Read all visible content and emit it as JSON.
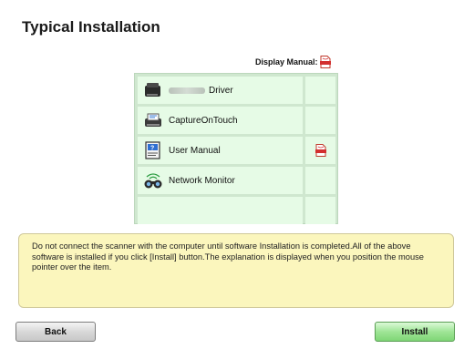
{
  "title": "Typical Installation",
  "display_manual": {
    "label": "Display Manual:",
    "icon": "pdf-icon"
  },
  "software_list": [
    {
      "label": "Driver",
      "icon": "scanner-icon",
      "has_manual": false,
      "name_blurred": true
    },
    {
      "label": "CaptureOnTouch",
      "icon": "scanner-capture-icon",
      "has_manual": false
    },
    {
      "label": "User Manual",
      "icon": "user-manual-icon",
      "has_manual": true
    },
    {
      "label": "Network Monitor",
      "icon": "network-monitor-icon",
      "has_manual": false
    },
    {
      "label": "",
      "icon": "",
      "has_manual": false
    }
  ],
  "notice": "Do not connect the scanner with the computer until software Installation is completed.All of the above software is installed if you click [Install] button.The explanation is displayed when you position the mouse pointer over the item.",
  "buttons": {
    "back": "Back",
    "install": "Install"
  },
  "colors": {
    "list_background": "#cfe7cf",
    "row_background": "#e6fbe6",
    "notice_background": "#fbf6bd",
    "install_button": "#9fe596"
  }
}
